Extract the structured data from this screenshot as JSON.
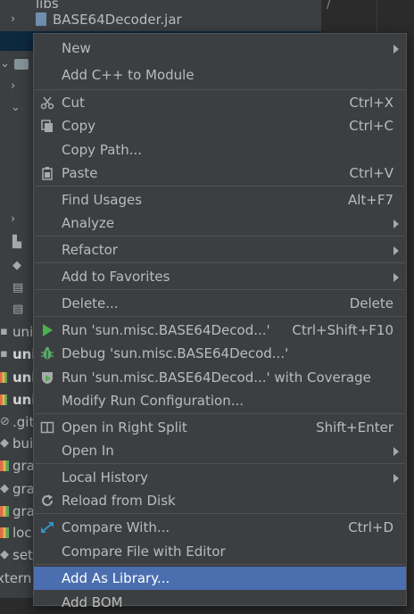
{
  "tree": {
    "rows": [
      {
        "arrow": "",
        "icon": "",
        "label": "libs",
        "bold": false
      },
      {
        "arrow": "›",
        "icon": "jar-icon",
        "label": "BASE64Decoder.jar",
        "bold": false
      },
      {
        "arrow": "⌄",
        "icon": "folder-icon",
        "label": "",
        "bold": false
      },
      {
        "arrow": "›",
        "icon": "folder-icon",
        "label": "",
        "bold": false
      },
      {
        "arrow": "⌄",
        "icon": "",
        "label": "",
        "bold": false
      },
      {
        "arrow": "›",
        "icon": "",
        "label": "",
        "bold": false
      },
      {
        "arrow": "",
        "icon": "",
        "label": "uni",
        "bold": false
      },
      {
        "arrow": "",
        "icon": "",
        "label": "uni",
        "bold": true
      },
      {
        "arrow": "",
        "icon": "",
        "label": "uni",
        "bold": true
      },
      {
        "arrow": "",
        "icon": "",
        "label": "uni",
        "bold": true
      },
      {
        "arrow": "",
        "icon": "",
        "label": ".git",
        "bold": false
      },
      {
        "arrow": "",
        "icon": "",
        "label": "bui",
        "bold": false
      },
      {
        "arrow": "",
        "icon": "",
        "label": "gra",
        "bold": false
      },
      {
        "arrow": "",
        "icon": "",
        "label": "gra",
        "bold": false
      },
      {
        "arrow": "",
        "icon": "",
        "label": "gra",
        "bold": false
      },
      {
        "arrow": "",
        "icon": "",
        "label": "loc",
        "bold": false
      },
      {
        "arrow": "",
        "icon": "",
        "label": "set",
        "bold": false
      },
      {
        "arrow": "",
        "icon": "",
        "label": "xtern",
        "bold": false
      }
    ]
  },
  "menu": {
    "items": [
      {
        "label": "New",
        "shortcut": "",
        "submenu": true,
        "icon": ""
      },
      {
        "label": "Add C++ to Module",
        "shortcut": "",
        "submenu": false,
        "icon": ""
      },
      {
        "label": "Cut",
        "shortcut": "Ctrl+X",
        "submenu": false,
        "icon": "scissors-icon"
      },
      {
        "label": "Copy",
        "shortcut": "Ctrl+C",
        "submenu": false,
        "icon": "copy-icon"
      },
      {
        "label": "Copy Path...",
        "shortcut": "",
        "submenu": false,
        "icon": ""
      },
      {
        "label": "Paste",
        "shortcut": "Ctrl+V",
        "submenu": false,
        "icon": "clipboard-icon"
      },
      {
        "label": "Find Usages",
        "shortcut": "Alt+F7",
        "submenu": false,
        "icon": ""
      },
      {
        "label": "Analyze",
        "shortcut": "",
        "submenu": true,
        "icon": ""
      },
      {
        "label": "Refactor",
        "shortcut": "",
        "submenu": true,
        "icon": ""
      },
      {
        "label": "Add to Favorites",
        "shortcut": "",
        "submenu": true,
        "icon": ""
      },
      {
        "label": "Delete...",
        "shortcut": "Delete",
        "submenu": false,
        "icon": ""
      },
      {
        "label": "Run 'sun.misc.BASE64Decod...'",
        "shortcut": "Ctrl+Shift+F10",
        "submenu": false,
        "icon": "run-icon"
      },
      {
        "label": "Debug 'sun.misc.BASE64Decod...'",
        "shortcut": "",
        "submenu": false,
        "icon": "debug-icon"
      },
      {
        "label": "Run 'sun.misc.BASE64Decod...' with Coverage",
        "shortcut": "",
        "submenu": false,
        "icon": "coverage-icon"
      },
      {
        "label": "Modify Run Configuration...",
        "shortcut": "",
        "submenu": false,
        "icon": ""
      },
      {
        "label": "Open in Right Split",
        "shortcut": "Shift+Enter",
        "submenu": false,
        "icon": "split-icon"
      },
      {
        "label": "Open In",
        "shortcut": "",
        "submenu": true,
        "icon": ""
      },
      {
        "label": "Local History",
        "shortcut": "",
        "submenu": true,
        "icon": ""
      },
      {
        "label": "Reload from Disk",
        "shortcut": "",
        "submenu": false,
        "icon": "reload-icon"
      },
      {
        "label": "Compare With...",
        "shortcut": "Ctrl+D",
        "submenu": false,
        "icon": "compare-icon"
      },
      {
        "label": "Compare File with Editor",
        "shortcut": "",
        "submenu": false,
        "icon": ""
      },
      {
        "label": "Add As Library...",
        "shortcut": "",
        "submenu": false,
        "icon": "",
        "highlighted": true
      },
      {
        "label": "Add BOM",
        "shortcut": "",
        "submenu": false,
        "icon": ""
      }
    ]
  },
  "colors": {
    "menu_bg": "#3c3f41",
    "highlight": "#4b6eaf",
    "tree_bg": "#3c3f41",
    "editor_bg": "#2b2b2b",
    "run_green": "#4caf50"
  }
}
